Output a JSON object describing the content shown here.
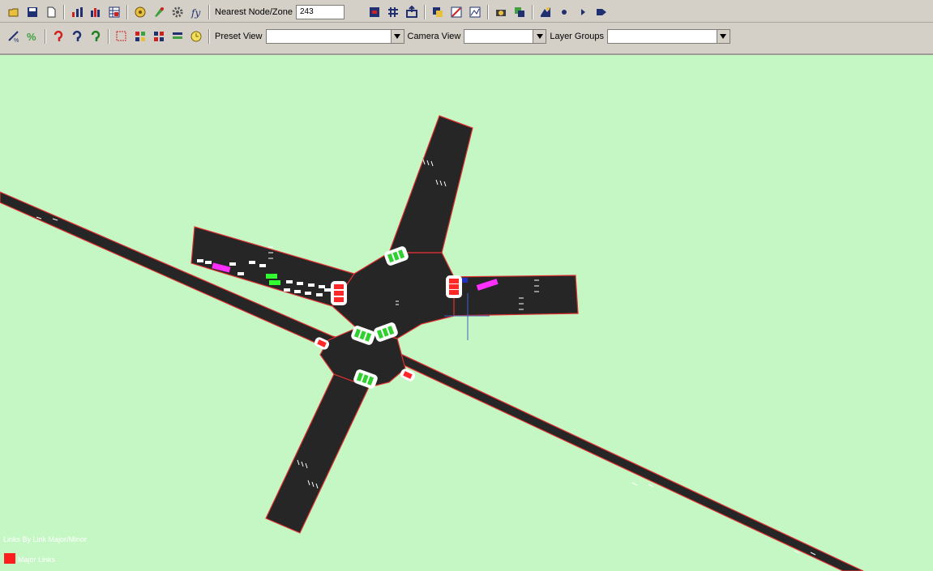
{
  "toolbar_top": {
    "left_icons": [
      "open-file-icon",
      "save-icon",
      "new-file-icon",
      "signal-bars-icon",
      "bar-chart-icon",
      "table-stats-icon",
      "vehicle-settings-icon",
      "palette-icon",
      "gear-tool-icon",
      "function-icon"
    ],
    "nearest_label": "Nearest Node/Zone",
    "nearest_value": "243",
    "right_icons": [
      "record-icon",
      "grid-icon",
      "export-icon",
      "layers-icon",
      "zoom-region-icon",
      "route-icon",
      "camera-icon",
      "overlay-icon",
      "run-script-icon",
      "dot-icon",
      "step-icon",
      "fast-forward-icon"
    ]
  },
  "toolbar_bottom": {
    "left_icons": [
      "measure-icon",
      "percent-icon",
      "hook-red-icon",
      "hook-blue-icon",
      "hook-green-icon",
      "select-area-icon",
      "nodes-icon",
      "links-icon",
      "list-icon",
      "clock-icon"
    ],
    "preset_label": "Preset View",
    "preset_value": "",
    "camera_label": "Camera View",
    "camera_value": "",
    "layer_label": "Layer Groups",
    "layer_value": ""
  },
  "colors": {
    "background": "#c4f7c4",
    "road": "#262626",
    "road_edge": "#e03030",
    "vehicle_red": "#ff2828",
    "vehicle_green": "#30ff30",
    "vehicle_magenta": "#ff30ff",
    "legend_major": "#ff1e1e"
  },
  "legend": {
    "title": "Links By Link Major/Minor",
    "items": [
      {
        "label": "Major Links",
        "color": "#ff1e1e"
      }
    ]
  }
}
